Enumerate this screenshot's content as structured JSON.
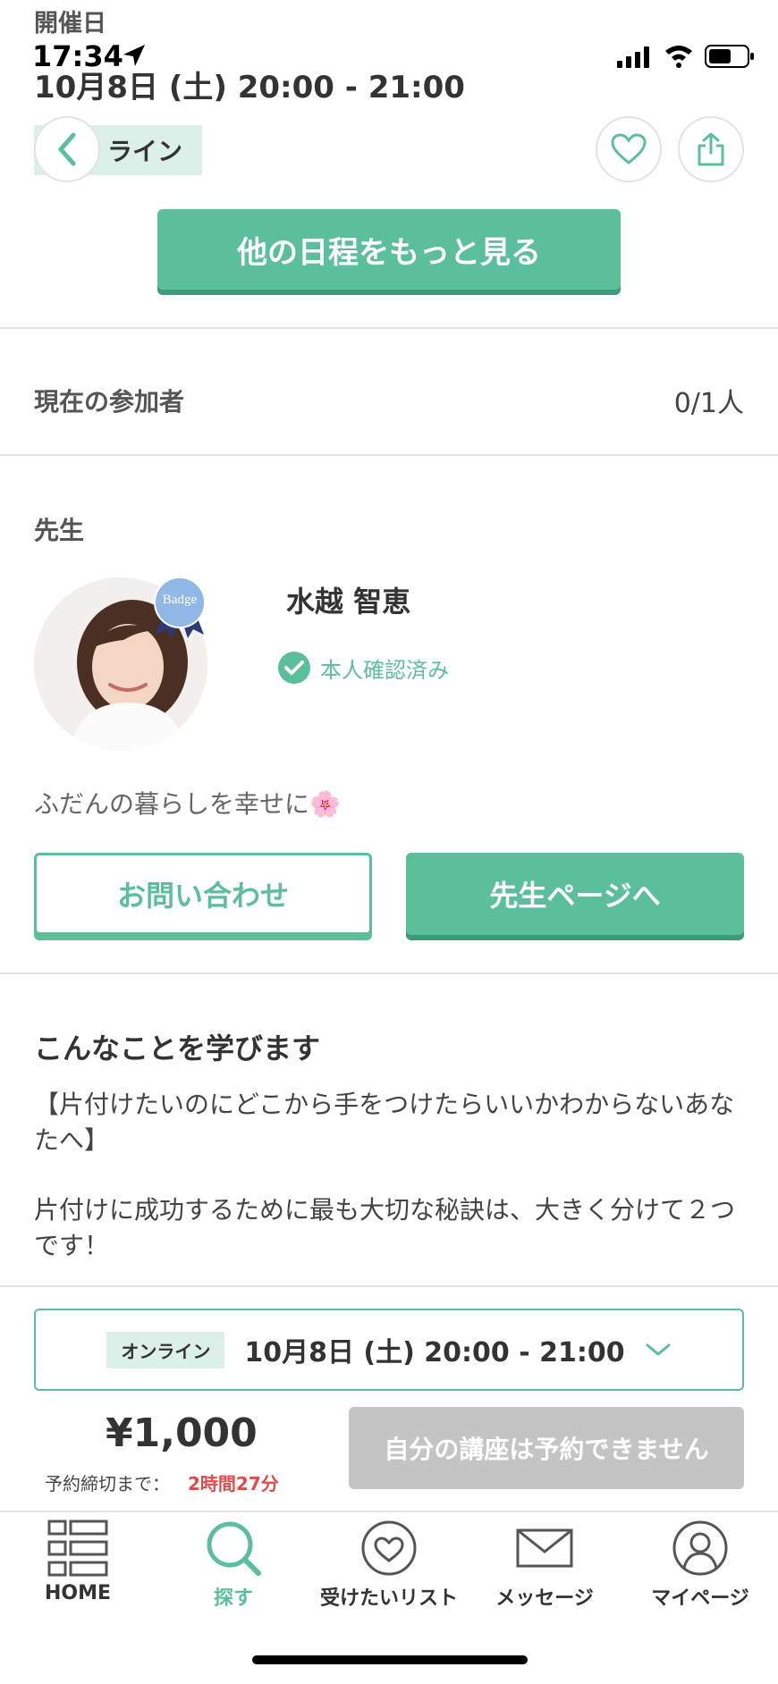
{
  "status_bar": {
    "time": "17:34"
  },
  "header": {
    "date_label": "開催日",
    "date_value": "10月8日 (土) 20:00 - 21:00",
    "format_tag": "ライン"
  },
  "other_dates_button": "他の日程をもっと見る",
  "participants": {
    "label": "現在の参加者",
    "value": "0/1人"
  },
  "teacher": {
    "section_label": "先生",
    "badge_text": "Badge",
    "name": "水越 智恵",
    "verified_label": "本人確認済み",
    "tagline": "ふだんの暮らしを幸せに🌸",
    "contact_button": "お問い合わせ",
    "page_button": "先生ページへ"
  },
  "learn": {
    "heading": "こんなことを学びます",
    "paragraph1": "【片付けたいのにどこから手をつけたらいいかわからないあなたへ】",
    "paragraph2": "片付けに成功するために最も大切な秘訣は、大きく分けて２つです！"
  },
  "booking": {
    "tag": "オンライン",
    "date": "10月8日 (土) 20:00 - 21:00",
    "price": "¥1,000",
    "deadline_label": "予約締切まで：",
    "deadline_value": "2時間27分",
    "reserve_button": "自分の講座は予約できません"
  },
  "nav": [
    {
      "label": "HOME",
      "icon": "home-grid-icon"
    },
    {
      "label": "探す",
      "icon": "search-icon"
    },
    {
      "label": "受けたいリスト",
      "icon": "heart-icon"
    },
    {
      "label": "メッセージ",
      "icon": "mail-icon"
    },
    {
      "label": "マイページ",
      "icon": "user-icon"
    }
  ],
  "colors": {
    "accent": "#5bbf9a",
    "deadline": "#e04b4b",
    "disabled": "#c4c4c4"
  }
}
